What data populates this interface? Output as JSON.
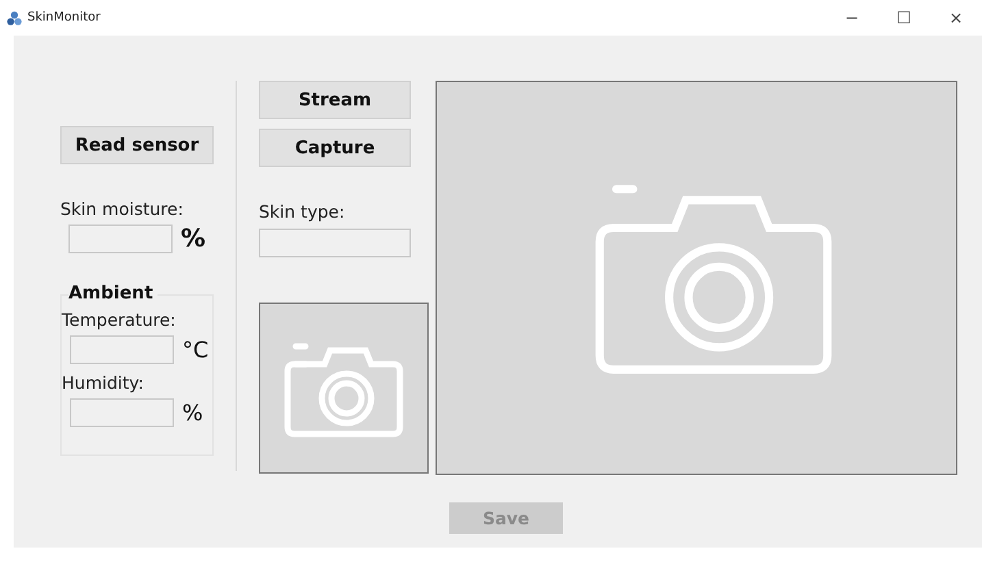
{
  "window": {
    "title": "SkinMonitor",
    "controls": [
      "−",
      "☐",
      "×"
    ]
  },
  "sensor": {
    "read_button": "Read sensor",
    "moisture_label": "Skin moisture:",
    "moisture_unit": "%"
  },
  "ambient": {
    "title": "Ambient",
    "temperature_label": "Temperature:",
    "temperature_unit": "°C",
    "humidity_label": "Humidity:",
    "humidity_unit": "%"
  },
  "camera": {
    "stream_button": "Stream",
    "capture_button": "Capture",
    "skin_type_label": "Skin type:"
  },
  "save_button": {
    "label": "Save",
    "disabled": true
  }
}
